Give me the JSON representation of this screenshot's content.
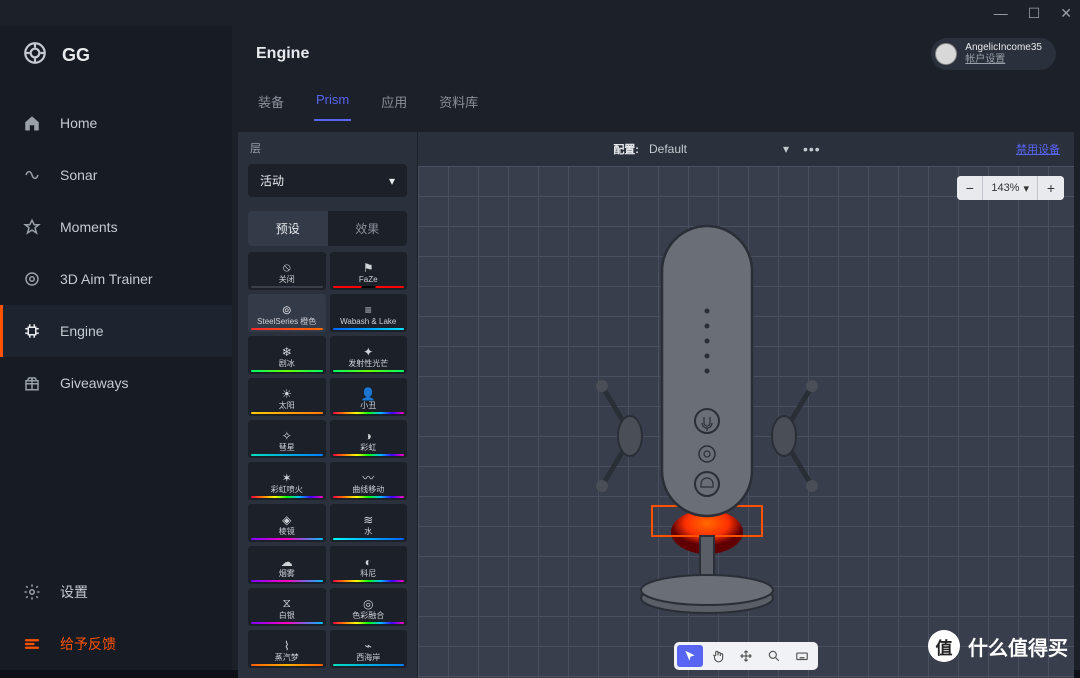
{
  "titlebar": {
    "min": "—",
    "max": "☐",
    "close": "✕"
  },
  "brand": "GG",
  "nav": [
    {
      "label": "Home"
    },
    {
      "label": "Sonar"
    },
    {
      "label": "Moments"
    },
    {
      "label": "3D Aim Trainer"
    },
    {
      "label": "Engine"
    },
    {
      "label": "Giveaways"
    }
  ],
  "settings": "设置",
  "feedback": "给予反馈",
  "header": {
    "title": "Engine"
  },
  "user": {
    "name": "AngelicIncome35",
    "link": "帐户设置"
  },
  "tabs": [
    "装备",
    "Prism",
    "应用",
    "资料库"
  ],
  "active_tab": 1,
  "panel": {
    "layer_label": "层",
    "layer_value": "活动",
    "subtabs": [
      "预设",
      "效果"
    ],
    "active_subtab": 0
  },
  "presets": [
    {
      "label": "关闭",
      "bar": "bar-off"
    },
    {
      "label": "FaZe",
      "bar": "bar-faze"
    },
    {
      "label": "SteelSeries 橙色",
      "bar": "bar-red"
    },
    {
      "label": "Wabash & Lake",
      "bar": "bar-blue"
    },
    {
      "label": "剧冰",
      "bar": "bar-green"
    },
    {
      "label": "发射性光芒",
      "bar": "bar-green"
    },
    {
      "label": "太阳",
      "bar": "bar-sun"
    },
    {
      "label": "小丑",
      "bar": "bar-rainbow"
    },
    {
      "label": "彗星",
      "bar": "bar-teal"
    },
    {
      "label": "彩虹",
      "bar": "bar-rainbow"
    },
    {
      "label": "彩虹喷火",
      "bar": "bar-rainbow"
    },
    {
      "label": "曲线移动",
      "bar": "bar-rainbow"
    },
    {
      "label": "棱镜",
      "bar": "bar-purple"
    },
    {
      "label": "水",
      "bar": "bar-cyan"
    },
    {
      "label": "烟雾",
      "bar": "bar-purple"
    },
    {
      "label": "科尼",
      "bar": "bar-rainbow"
    },
    {
      "label": "白银",
      "bar": "bar-purple"
    },
    {
      "label": "色彩融合",
      "bar": "bar-rainbow"
    },
    {
      "label": "蒸汽梦",
      "bar": "bar-wave"
    },
    {
      "label": "西海岸",
      "bar": "bar-teal"
    }
  ],
  "selected_preset": 2,
  "canvas": {
    "config_label": "配置:",
    "config_value": "Default",
    "disable_link": "禁用设备",
    "zoom": "143%"
  },
  "tools": [
    "pointer",
    "pan",
    "move",
    "zoom-tool",
    "keyboard"
  ],
  "watermark": "什么值得买"
}
